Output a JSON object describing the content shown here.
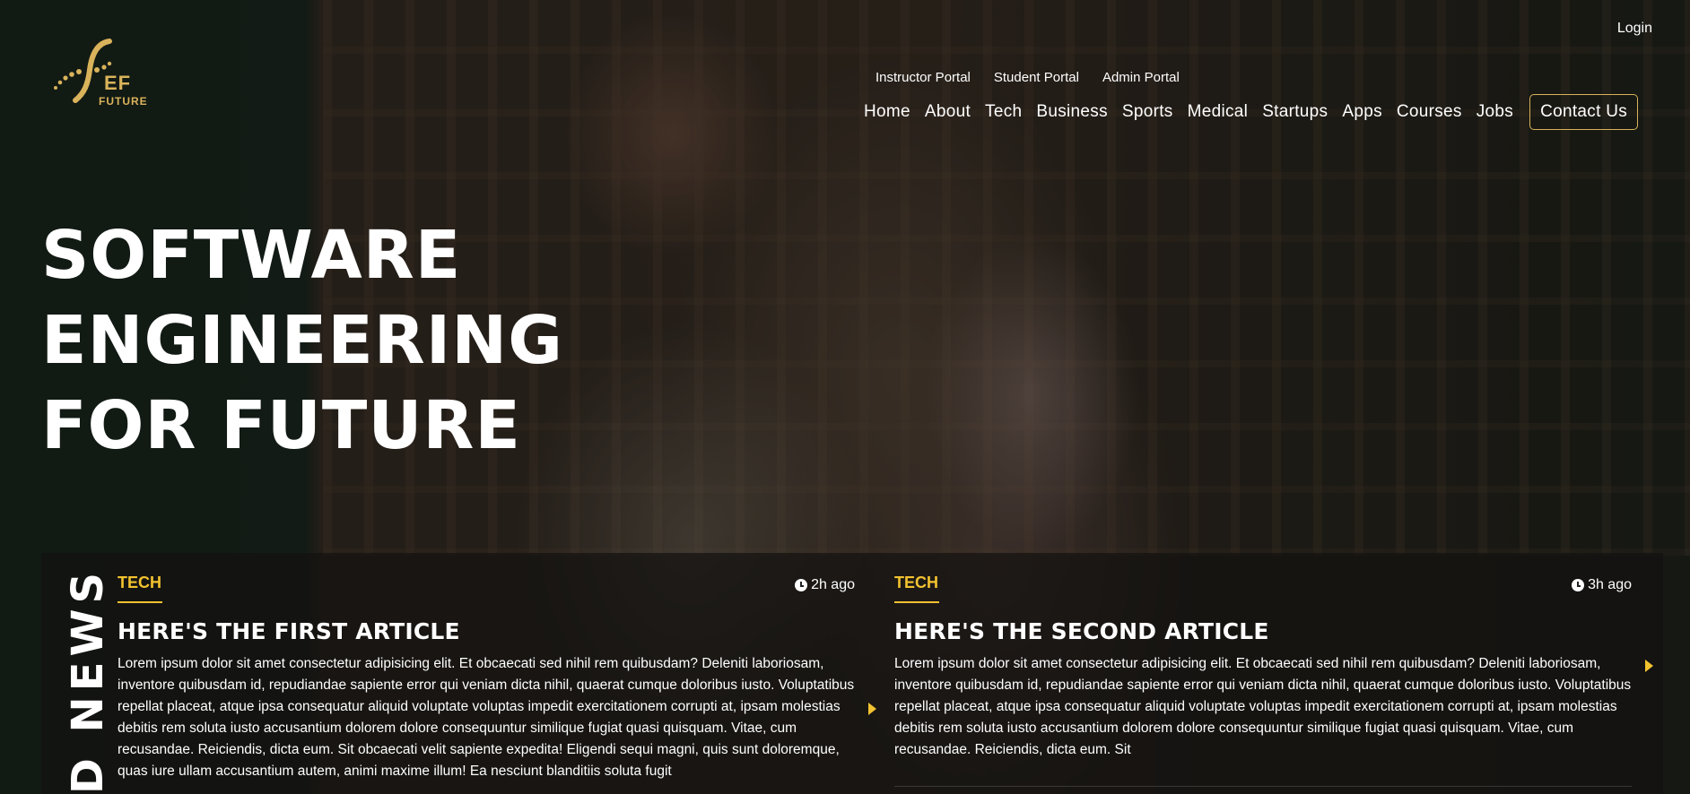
{
  "brand": {
    "logo_main": "EF",
    "logo_sub": "FUTURE"
  },
  "top": {
    "login": "Login"
  },
  "portals": [
    "Instructor Portal",
    "Student Portal",
    "Admin Portal"
  ],
  "nav": [
    "Home",
    "About",
    "Tech",
    "Business",
    "Sports",
    "Medical",
    "Startups",
    "Apps",
    "Courses",
    "Jobs"
  ],
  "contact_label": "Contact Us",
  "hero": {
    "title": "SOFTWARE ENGINEERING FOR FUTURE"
  },
  "news": {
    "section_label": "D NEWS",
    "articles": [
      {
        "category": "TECH",
        "time": "2h ago",
        "title": "HERE'S THE FIRST ARTICLE",
        "body": "Lorem ipsum dolor sit amet consectetur adipisicing elit. Et obcaecati sed nihil rem quibusdam? Deleniti laboriosam, inventore quibusdam id, repudiandae sapiente error qui veniam dicta nihil, quaerat cumque doloribus iusto. Voluptatibus repellat placeat, atque ipsa consequatur aliquid voluptate voluptas impedit exercitationem corrupti at, ipsam molestias debitis rem soluta iusto accusantium dolorem dolore consequuntur similique fugiat quasi quisquam. Vitae, cum recusandae. Reiciendis, dicta eum. Sit obcaecati velit sapiente expedita! Eligendi sequi magni, quis sunt doloremque, quas iure ullam accusantium autem, animi maxime illum! Ea nesciunt blanditiis soluta fugit"
      },
      {
        "category": "TECH",
        "time": "3h ago",
        "title": "HERE'S THE SECOND ARTICLE",
        "body": "Lorem ipsum dolor sit amet consectetur adipisicing elit. Et obcaecati sed nihil rem quibusdam? Deleniti laboriosam, inventore quibusdam id, repudiandae sapiente error qui veniam dicta nihil, quaerat cumque doloribus iusto. Voluptatibus repellat placeat, atque ipsa consequatur aliquid voluptate voluptas impedit exercitationem corrupti at, ipsam molestias debitis rem soluta iusto accusantium dolorem dolore consequuntur similique fugiat quasi quisquam. Vitae, cum recusandae. Reiciendis, dicta eum. Sit"
      }
    ]
  },
  "colors": {
    "accent": "#f2c230",
    "gold": "#d9b35b",
    "text": "#ffffff"
  },
  "icons": {
    "clock": "clock-icon",
    "next": "caret-right-icon"
  }
}
